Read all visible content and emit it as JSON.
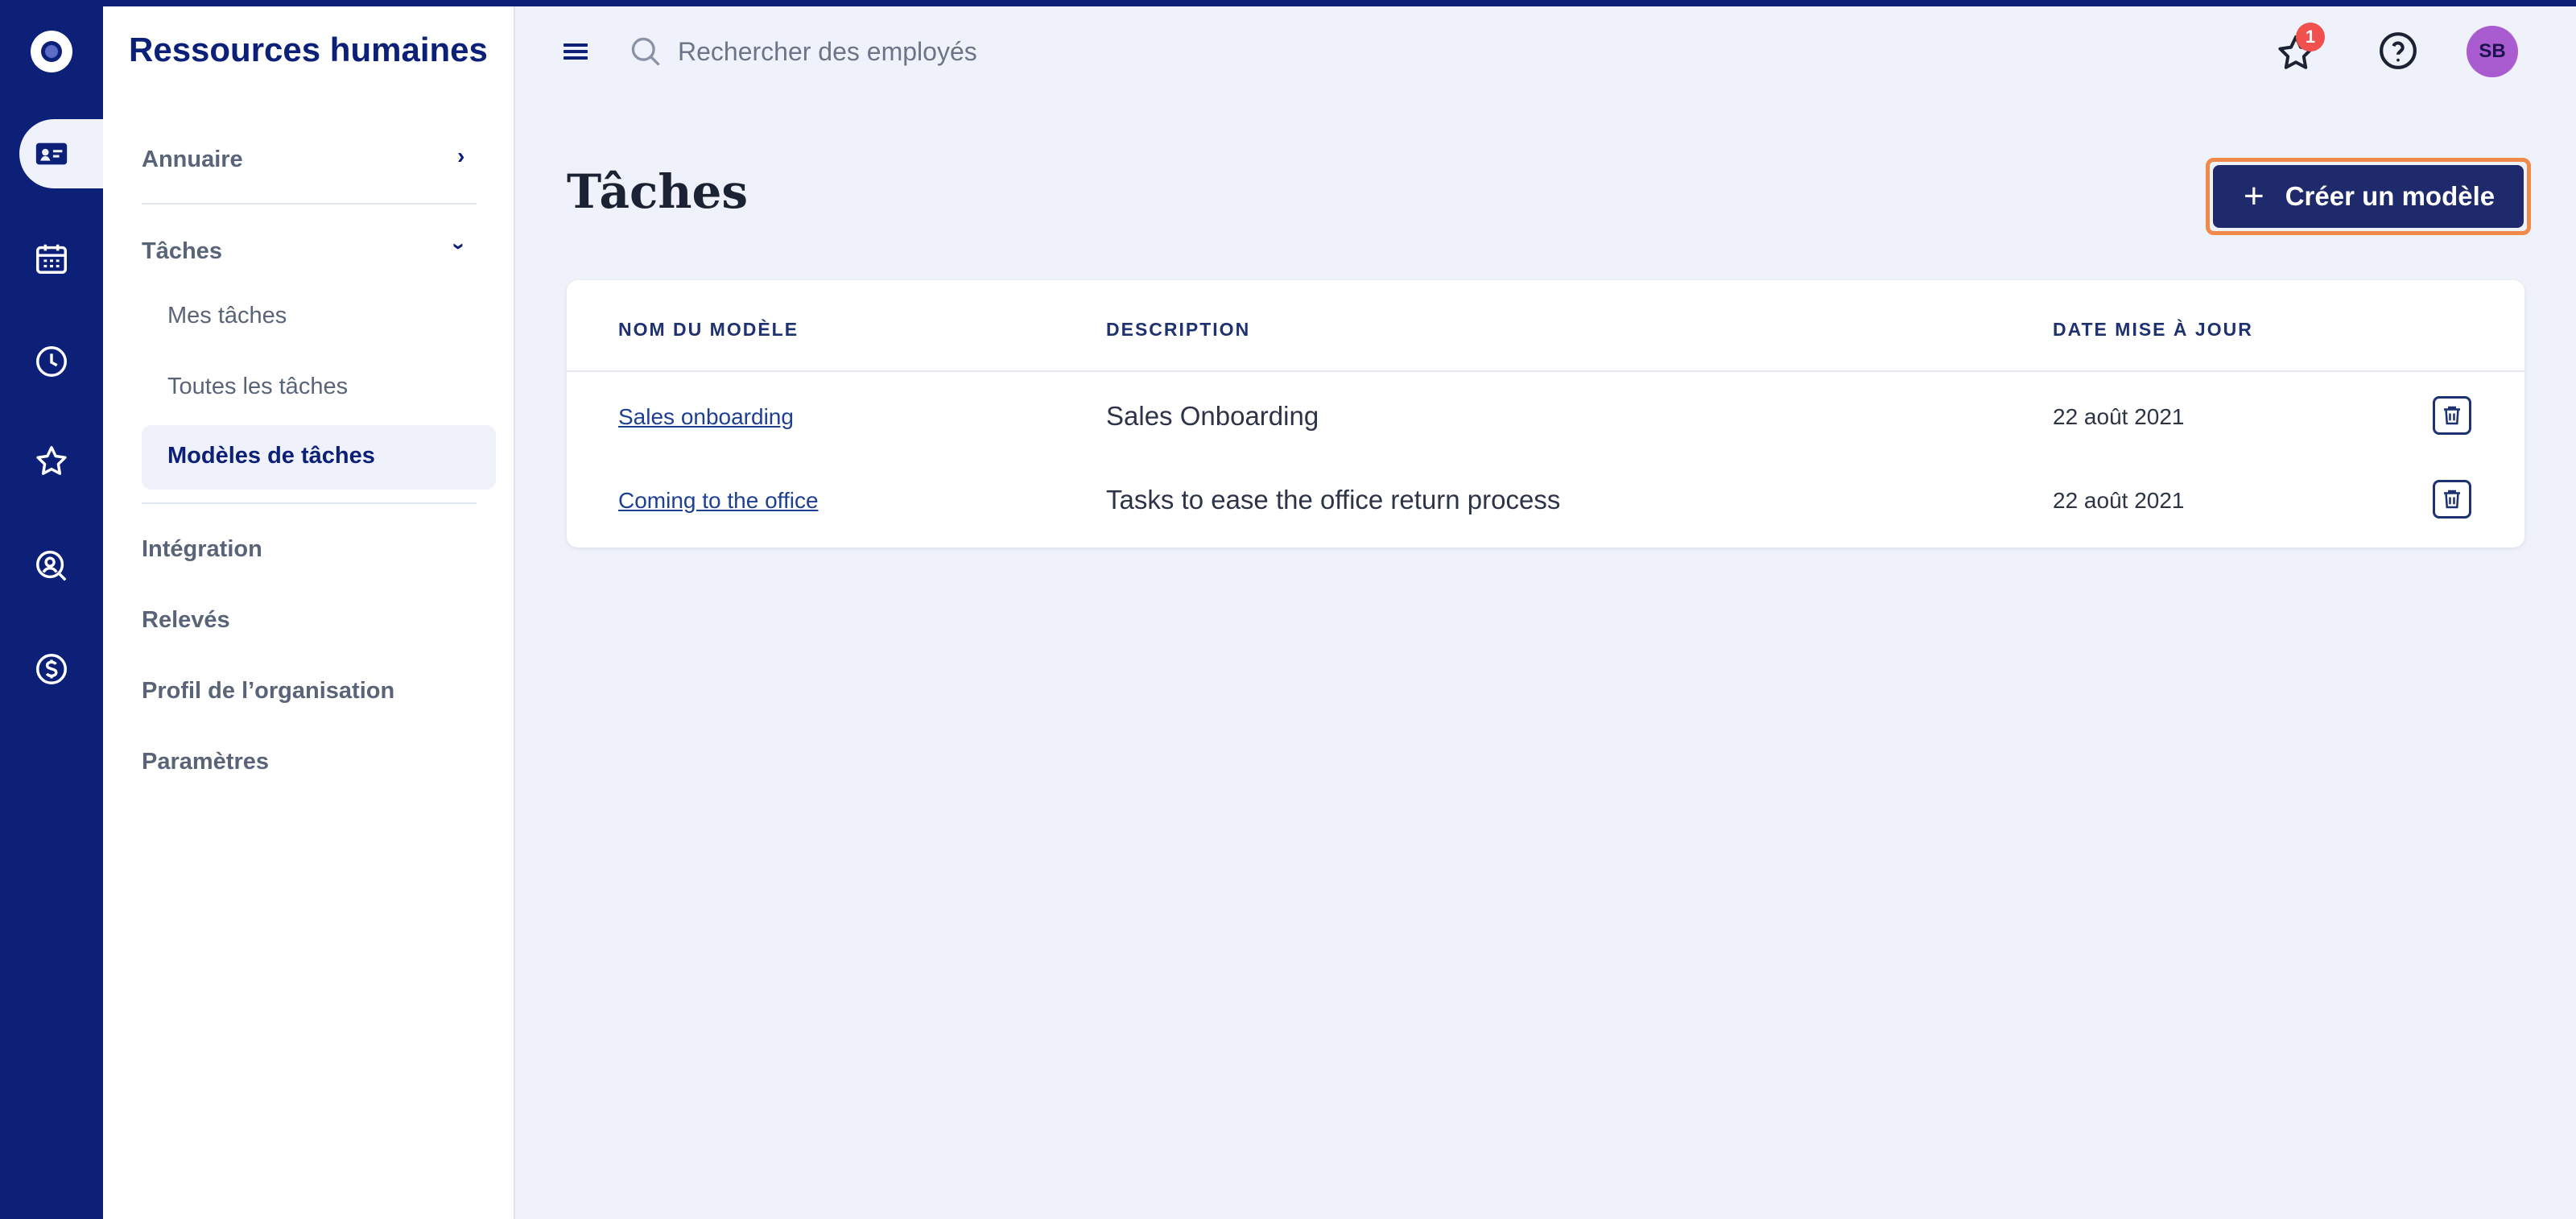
{
  "app": {
    "title": "Ressources humaines"
  },
  "rail": {
    "items": [
      {
        "icon": "logo-icon"
      },
      {
        "icon": "id-card-icon",
        "active": true
      },
      {
        "icon": "calendar-icon"
      },
      {
        "icon": "clock-icon"
      },
      {
        "icon": "star-icon"
      },
      {
        "icon": "person-search-icon"
      },
      {
        "icon": "dollar-icon"
      }
    ]
  },
  "sidebar": {
    "annuaire": "Annuaire",
    "taches": "Tâches",
    "mes_taches": "Mes tâches",
    "toutes_taches": "Toutes les tâches",
    "modeles_taches": "Modèles de tâches",
    "integration": "Intégration",
    "releves": "Relevés",
    "profil": "Profil de l’organisation",
    "parametres": "Paramètres"
  },
  "topbar": {
    "search_placeholder": "Rechercher des employés",
    "notifications_count": "1",
    "avatar_initials": "SB"
  },
  "page": {
    "title": "Tâches",
    "create_button": "Créer un modèle"
  },
  "table": {
    "headers": [
      "NOM DU MODÈLE",
      "DESCRIPTION",
      "DATE MISE À JOUR"
    ],
    "rows": [
      {
        "name": "Sales onboarding",
        "description": "Sales Onboarding",
        "date": "22 août 2021"
      },
      {
        "name": "Coming to the office",
        "description": "Tasks to ease the office return process",
        "date": "22 août 2021"
      }
    ]
  },
  "colors": {
    "brand": "#0c2078",
    "accent_outline": "#f08a4b",
    "badge": "#f0514f",
    "avatar": "#a95ccf"
  }
}
